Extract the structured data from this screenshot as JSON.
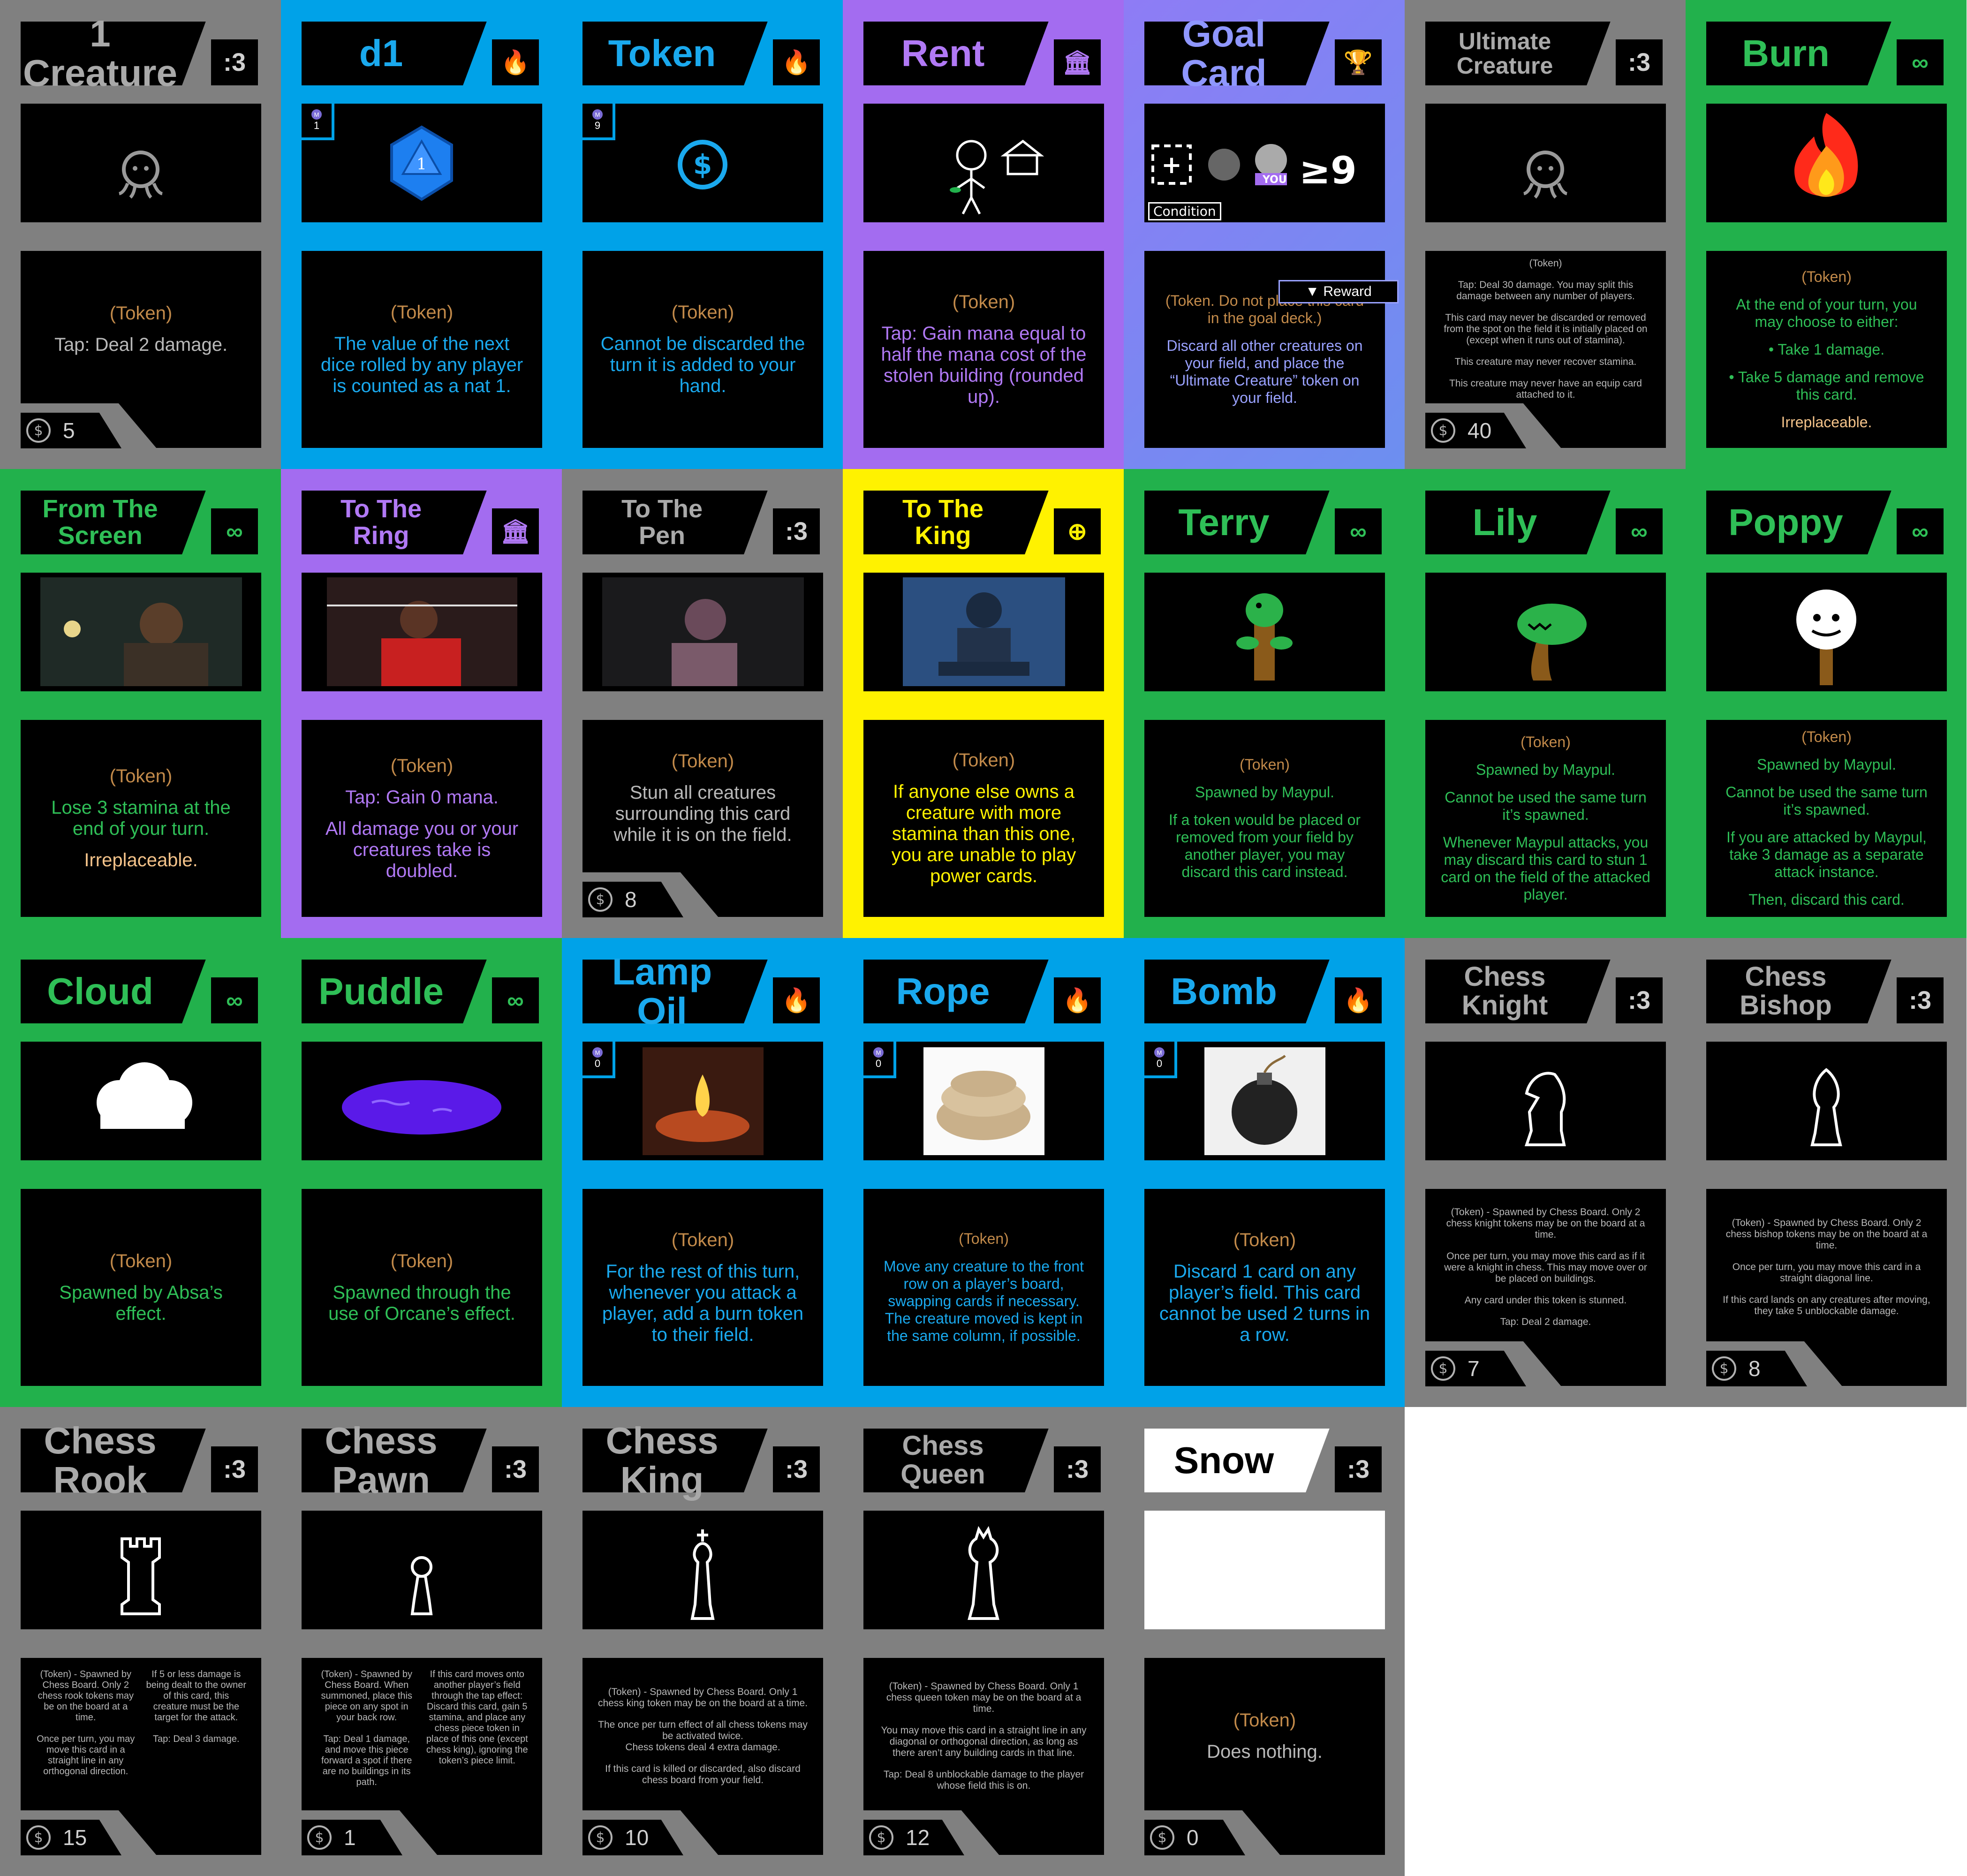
{
  "colors": {
    "grey": "#808080",
    "blue": "#00a2e8",
    "purple": "#a36cf0",
    "green": "#22b14c",
    "yellow": "#fff200",
    "goal": "#7f86f0",
    "token_brown": "#c28a4a"
  },
  "cards": [
    {
      "name": "1 Creature",
      "icon": ":3",
      "icon_name": "cat-face-icon",
      "bg": "grey",
      "lines": [
        "(Token)",
        "Tap: Deal 2 damage."
      ],
      "cost": "5",
      "art": "octopus-doodle"
    },
    {
      "name": "d1",
      "icon": "🔥",
      "icon_name": "blue-flame-icon",
      "bg": "blue",
      "lines": [
        "(Token)",
        "The value of the next dice rolled by any player is counted as a nat 1."
      ],
      "mana": "1",
      "art": "d20-die"
    },
    {
      "name": "Token",
      "icon": "🔥",
      "icon_name": "blue-flame-icon",
      "bg": "blue",
      "lines": [
        "(Token)",
        "Cannot be discarded the turn it is added to your hand."
      ],
      "mana": "9",
      "art": "dollar-coin"
    },
    {
      "name": "Rent",
      "icon": "🏛",
      "icon_name": "building-icon",
      "bg": "purple",
      "lines": [
        "(Token)",
        "Tap: Gain mana equal to half the mana cost of the stolen building (rounded up)."
      ],
      "art": "stick-figure-house"
    },
    {
      "name": "Goal Card",
      "icon": "🏆",
      "icon_name": "trophy-icon",
      "bg": "goal",
      "lines": [
        "(Token. Do not place this card in the goal deck.)",
        "Discard all other creatures on your field, and place the “Ultimate Creature” token on your field."
      ],
      "condition": "Condition",
      "reward": "Reward",
      "goal_you": "YOU",
      "goal_ge": "≥9",
      "art": "goal-condition"
    },
    {
      "name": "Ultimate Creature",
      "icon": ":3",
      "icon_name": "cat-face-icon",
      "bg": "grey",
      "lines": [
        "(Token)",
        "Tap: Deal 30 damage. You may split this damage between any number of players.",
        "This card may never be discarded or removed from the spot on the field it is initially placed on (except when it runs out of stamina).",
        "This creature may never recover stamina.",
        "This creature may never have an equip card attached to it."
      ],
      "cost": "40",
      "art": "octopus-doodle",
      "small": true
    },
    {
      "name": "Burn",
      "icon": "∞",
      "icon_name": "infinity-icon",
      "bg": "green",
      "lines": [
        "(Token)",
        "At the end of your turn, you may choose to either:",
        "• Take 1 damage.",
        "• Take 5 damage and remove this card.",
        "Irreplaceable."
      ],
      "art": "fire"
    },
    {
      "name": "From The\nScreen",
      "icon": "∞",
      "icon_name": "infinity-icon",
      "bg": "green",
      "lines": [
        "(Token)",
        "Lose 3 stamina at the end of your turn.",
        "Irreplaceable."
      ],
      "art": "photo-screen"
    },
    {
      "name": "To The\nRing",
      "icon": "🏛",
      "icon_name": "building-icon",
      "bg": "purple",
      "lines": [
        "(Token)",
        "Tap: Gain 0 mana.",
        "All damage you or your creatures take is doubled."
      ],
      "art": "photo-ring"
    },
    {
      "name": "To The\nPen",
      "icon": ":3",
      "icon_name": "cat-face-icon",
      "bg": "grey",
      "lines": [
        "(Token)",
        "Stun all creatures surrounding this card while it is on the field."
      ],
      "cost": "8",
      "art": "photo-pen"
    },
    {
      "name": "To The\nKing",
      "icon": "⊕",
      "icon_name": "crosshair-icon",
      "bg": "yellow",
      "lines": [
        "(Token)",
        "If anyone else owns a creature with more stamina than this one, you are unable to play power cards."
      ],
      "art": "photo-king"
    },
    {
      "name": "Terry",
      "icon": "∞",
      "icon_name": "infinity-icon",
      "bg": "green",
      "lines": [
        "(Token)",
        "Spawned by Maypul.",
        "If a token would be placed or removed from your field by another player, you may discard this card instead."
      ],
      "art": "terry-creature"
    },
    {
      "name": "Lily",
      "icon": "∞",
      "icon_name": "infinity-icon",
      "bg": "green",
      "lines": [
        "(Token)",
        "Spawned by Maypul.",
        "Cannot be used the same turn it’s spawned.",
        "Whenever Maypul attacks, you may discard this card to stun 1 card on the field of the attacked player."
      ],
      "art": "lily-creature"
    },
    {
      "name": "Poppy",
      "icon": "∞",
      "icon_name": "infinity-icon",
      "bg": "green",
      "lines": [
        "(Token)",
        "Spawned by Maypul.",
        "Cannot be used the same turn it’s spawned.",
        "If you are attacked by Maypul, take 3 damage as a separate attack instance.",
        "Then, discard this card."
      ],
      "art": "poppy-creature"
    },
    {
      "name": "Cloud",
      "icon": "∞",
      "icon_name": "infinity-icon",
      "bg": "green",
      "lines": [
        "(Token)",
        "Spawned by Absa’s effect."
      ],
      "art": "cloud"
    },
    {
      "name": "Puddle",
      "icon": "∞",
      "icon_name": "infinity-icon",
      "bg": "green",
      "lines": [
        "(Token)",
        "Spawned through the use of Orcane’s effect."
      ],
      "art": "puddle"
    },
    {
      "name": "Lamp Oil",
      "icon": "🔥",
      "icon_name": "blue-flame-icon",
      "bg": "blue",
      "lines": [
        "(Token)",
        "For the rest of this turn, whenever you attack a player, add a burn token to their field."
      ],
      "mana": "0",
      "art": "photo-lamp"
    },
    {
      "name": "Rope",
      "icon": "🔥",
      "icon_name": "blue-flame-icon",
      "bg": "blue",
      "lines": [
        "(Token)",
        "Move any creature to the front row on a player’s board, swapping cards if necessary. The creature moved is kept in the same column, if possible."
      ],
      "mana": "0",
      "art": "photo-rope"
    },
    {
      "name": "Bomb",
      "icon": "🔥",
      "icon_name": "blue-flame-icon",
      "bg": "blue",
      "lines": [
        "(Token)",
        "Discard 1 card on any player’s field. This card cannot be used 2 turns in a row."
      ],
      "mana": "0",
      "art": "photo-bomb"
    },
    {
      "name": "Chess Knight",
      "icon": ":3",
      "icon_name": "cat-face-icon",
      "bg": "grey",
      "lines": [
        "(Token) - Spawned by Chess Board. Only 2 chess knight tokens may be on the board at a time.",
        "Once per turn, you may move this card as if it were a knight in chess. This may move over or be placed on buildings.",
        "Any card under this token is stunned.",
        "Tap: Deal 2 damage."
      ],
      "cost": "7",
      "art": "chess-knight",
      "small": true
    },
    {
      "name": "Chess Bishop",
      "icon": ":3",
      "icon_name": "cat-face-icon",
      "bg": "grey",
      "lines": [
        "(Token) - Spawned by Chess Board. Only 2 chess bishop tokens may be on the board at a time.",
        "Once per turn, you may move this card in a straight diagonal line.",
        "If this card lands on any creatures after moving, they take 5 unblockable damage."
      ],
      "cost": "8",
      "art": "chess-bishop",
      "small": true
    },
    {
      "name": "Chess Rook",
      "icon": ":3",
      "icon_name": "cat-face-icon",
      "bg": "grey",
      "col_a": "(Token) - Spawned by Chess Board. Only 2 chess rook tokens may be on the board at a time.\n\nOnce per turn, you may move this card in a straight line in any orthogonal direction.",
      "col_b": "If 5 or less damage is being dealt to the owner of this card, this creature must be the target for the attack.\n\nTap: Deal 3 damage.",
      "cost": "15",
      "art": "chess-rook"
    },
    {
      "name": "Chess Pawn",
      "icon": ":3",
      "icon_name": "cat-face-icon",
      "bg": "grey",
      "col_a": "(Token) - Spawned by Chess Board. When summoned, place this piece on any spot in your back row.\n\nTap: Deal 1 damage, and move this piece forward a spot if there are no buildings in its path.",
      "col_b": "If this card moves onto another player’s field through the tap effect: Discard this card, gain 5 stamina, and place any chess piece token in place of this one (except chess king), ignoring the token’s piece limit.",
      "cost": "1",
      "art": "chess-pawn"
    },
    {
      "name": "Chess King",
      "icon": ":3",
      "icon_name": "cat-face-icon",
      "bg": "grey",
      "lines": [
        "(Token) - Spawned by Chess Board. Only 1 chess king token may be on the board at a time.",
        "The once per turn effect of all chess tokens may be activated twice.\nChess tokens deal 4 extra damage.",
        "If this card is killed or discarded, also discard chess board from your field."
      ],
      "cost": "10",
      "art": "chess-king",
      "small": true
    },
    {
      "name": "Chess Queen",
      "icon": ":3",
      "icon_name": "cat-face-icon",
      "bg": "grey",
      "lines": [
        "(Token) - Spawned by Chess Board. Only 1 chess queen token may be on the board at a time.",
        "You may move this card in a straight line in any diagonal or orthogonal direction, as long as there aren’t any building cards in that line.",
        "Tap: Deal 8 unblockable damage to the player whose field this is on."
      ],
      "cost": "12",
      "art": "chess-queen",
      "small": true
    },
    {
      "name": "Snow",
      "icon": ":3",
      "icon_name": "cat-face-icon",
      "bg": "grey",
      "white_title": true,
      "lines": [
        "(Token)",
        "Does nothing."
      ],
      "cost": "0",
      "art": "snow"
    }
  ]
}
